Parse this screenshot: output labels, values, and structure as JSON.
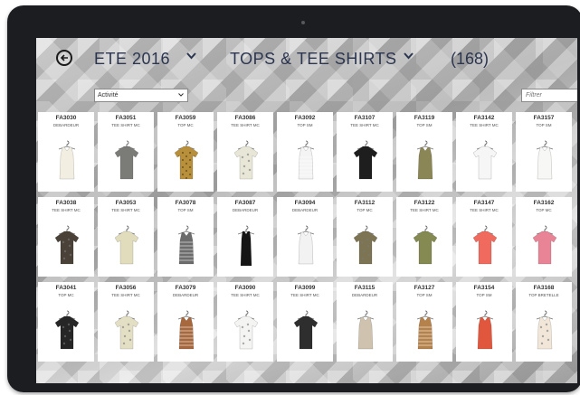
{
  "header": {
    "season": "ETE 2016",
    "category": "TOPS & TEE SHIRTS",
    "count": "(168)"
  },
  "filter_dropdown": {
    "value": "Activité"
  },
  "search": {
    "placeholder": "Filtrer"
  },
  "products": [
    {
      "code": "FA3030",
      "cat": "DEBARDEUR",
      "color": "#f2efe2",
      "shape": "tank"
    },
    {
      "code": "FA3051",
      "cat": "TEE SHIRT MC",
      "color": "#7b7b78",
      "shape": "tee"
    },
    {
      "code": "FA3059",
      "cat": "TOP MC",
      "color": "#b8903c",
      "shape": "tee",
      "pattern": "check"
    },
    {
      "code": "FA3086",
      "cat": "TEE SHIRT MC",
      "color": "#e8e6d6",
      "shape": "tee",
      "pattern": "print"
    },
    {
      "code": "FA3092",
      "cat": "TOP SM",
      "color": "#f4f4f4",
      "shape": "tank",
      "pattern": "stripe"
    },
    {
      "code": "FA3107",
      "cat": "TEE SHIRT MC",
      "color": "#1e1e1e",
      "shape": "tee"
    },
    {
      "code": "FA3119",
      "cat": "TOP SM",
      "color": "#8a8656",
      "shape": "tank"
    },
    {
      "code": "FA3142",
      "cat": "TEE SHIRT MC",
      "color": "#f6f6f6",
      "shape": "tee"
    },
    {
      "code": "FA3157",
      "cat": "TOP SM",
      "color": "#f7f7f5",
      "shape": "tank"
    },
    {
      "code": "FA3038",
      "cat": "TEE SHIRT MC",
      "color": "#4a4238",
      "shape": "tee",
      "pattern": "print"
    },
    {
      "code": "FA3053",
      "cat": "TEE SHIRT MC",
      "color": "#e0dcbc",
      "shape": "tee"
    },
    {
      "code": "FA3078",
      "cat": "TOP SM",
      "color": "#6c6c6c",
      "shape": "tank",
      "pattern": "stripe"
    },
    {
      "code": "FA3087",
      "cat": "DEBARDEUR",
      "color": "#151515",
      "shape": "dress"
    },
    {
      "code": "FA3094",
      "cat": "DEBARDEUR",
      "color": "#f2f2f2",
      "shape": "tank"
    },
    {
      "code": "FA3112",
      "cat": "TOP MC",
      "color": "#7d7454",
      "shape": "tee",
      "pattern": "print"
    },
    {
      "code": "FA3122",
      "cat": "TEE SHIRT MC",
      "color": "#848a52",
      "shape": "tee"
    },
    {
      "code": "FA3147",
      "cat": "TEE SHIRT MC",
      "color": "#f06a5e",
      "shape": "tee"
    },
    {
      "code": "FA3162",
      "cat": "TOP MC",
      "color": "#e98497",
      "shape": "tee"
    },
    {
      "code": "FA3041",
      "cat": "TOP MC",
      "color": "#262626",
      "shape": "tee",
      "pattern": "print"
    },
    {
      "code": "FA3056",
      "cat": "TEE SHIRT MC",
      "color": "#e3dfc4",
      "shape": "tee",
      "pattern": "print"
    },
    {
      "code": "FA3079",
      "cat": "DEBARDEUR",
      "color": "#a8683e",
      "shape": "tank",
      "pattern": "stripe"
    },
    {
      "code": "FA3090",
      "cat": "TEE SHIRT MC",
      "color": "#f4f4f2",
      "shape": "tee",
      "pattern": "print"
    },
    {
      "code": "FA3099",
      "cat": "TEE SHIRT MC",
      "color": "#2e2e2e",
      "shape": "tee"
    },
    {
      "code": "FA3115",
      "cat": "DEBARDEUR",
      "color": "#cfc2ae",
      "shape": "tank"
    },
    {
      "code": "FA3127",
      "cat": "TOP SM",
      "color": "#b6824c",
      "shape": "tank",
      "pattern": "stripe"
    },
    {
      "code": "FA3154",
      "cat": "TOP SM",
      "color": "#e0573e",
      "shape": "tank"
    },
    {
      "code": "FA3168",
      "cat": "TOP BRETELLE",
      "color": "#f1e6d8",
      "shape": "tank",
      "pattern": "print"
    }
  ]
}
